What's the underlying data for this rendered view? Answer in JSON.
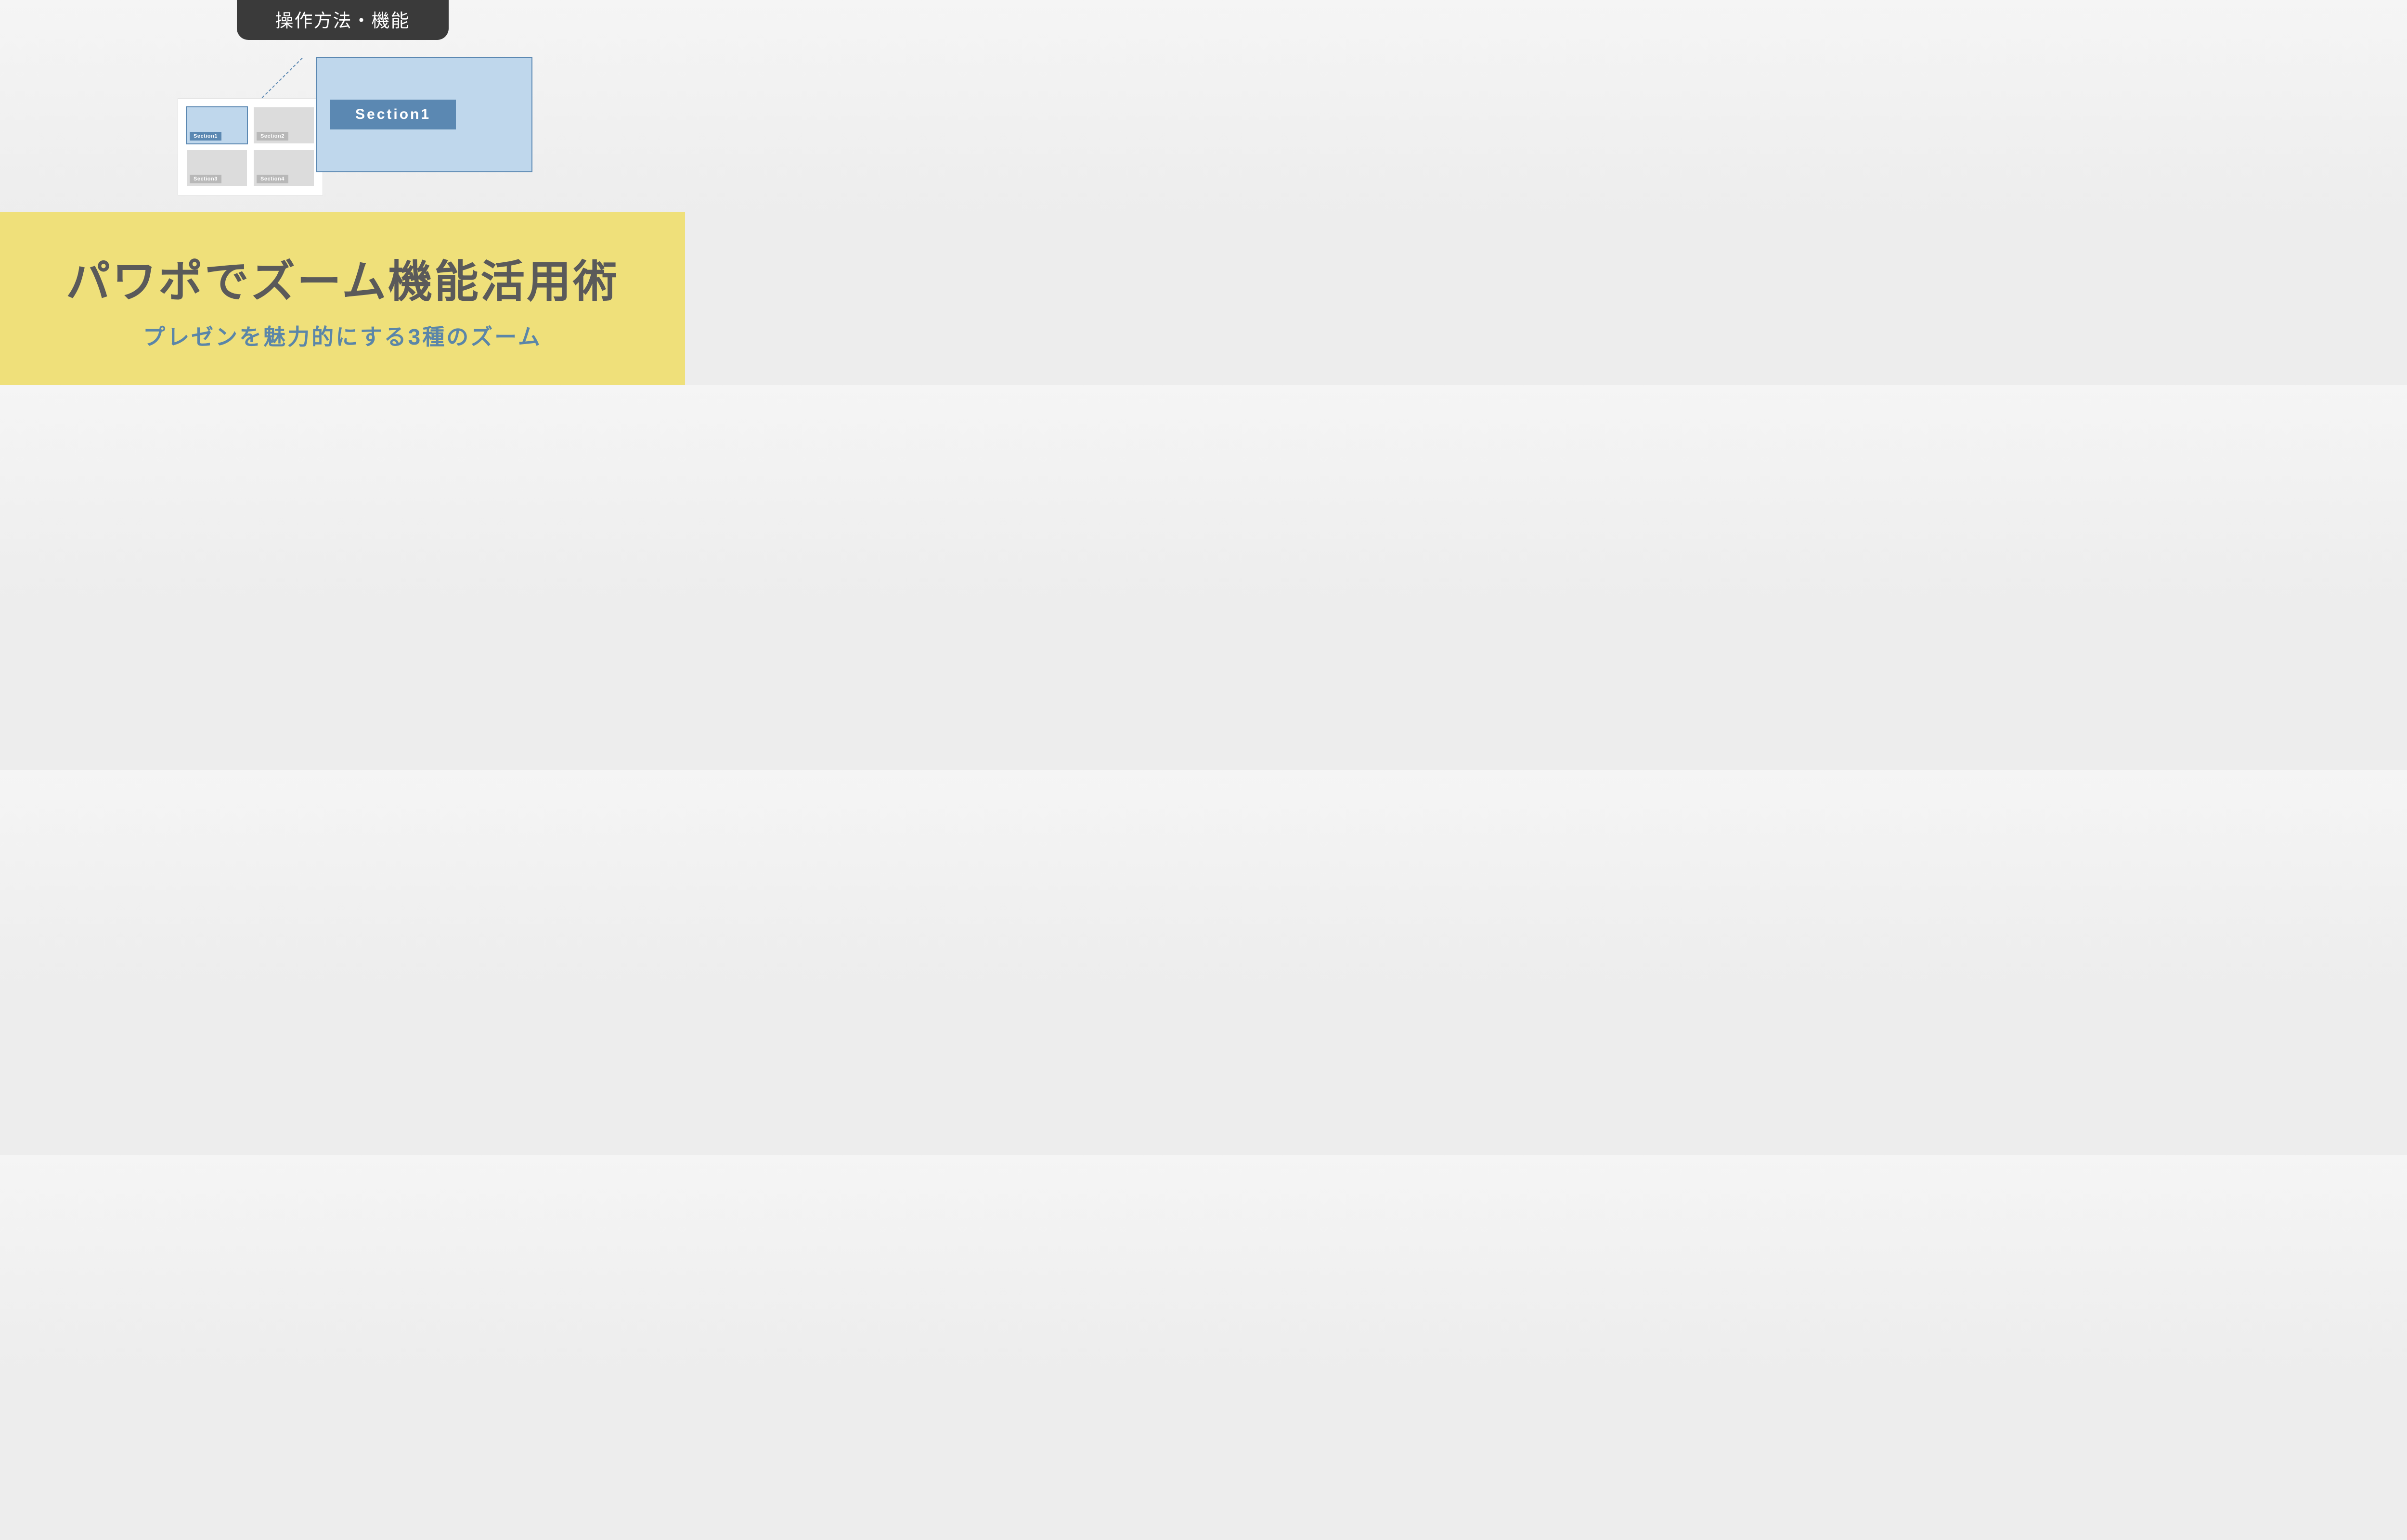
{
  "header": {
    "label": "操作方法・機能"
  },
  "mini": {
    "tiles": [
      {
        "label": "Section1",
        "selected": true
      },
      {
        "label": "Section2",
        "selected": false
      },
      {
        "label": "Section3",
        "selected": false
      },
      {
        "label": "Section4",
        "selected": false
      }
    ]
  },
  "zoom": {
    "label": "Section1"
  },
  "footer": {
    "title": "パワポでズーム機能活用術",
    "subtitle": "プレゼンを魅力的にする3種のズーム"
  }
}
